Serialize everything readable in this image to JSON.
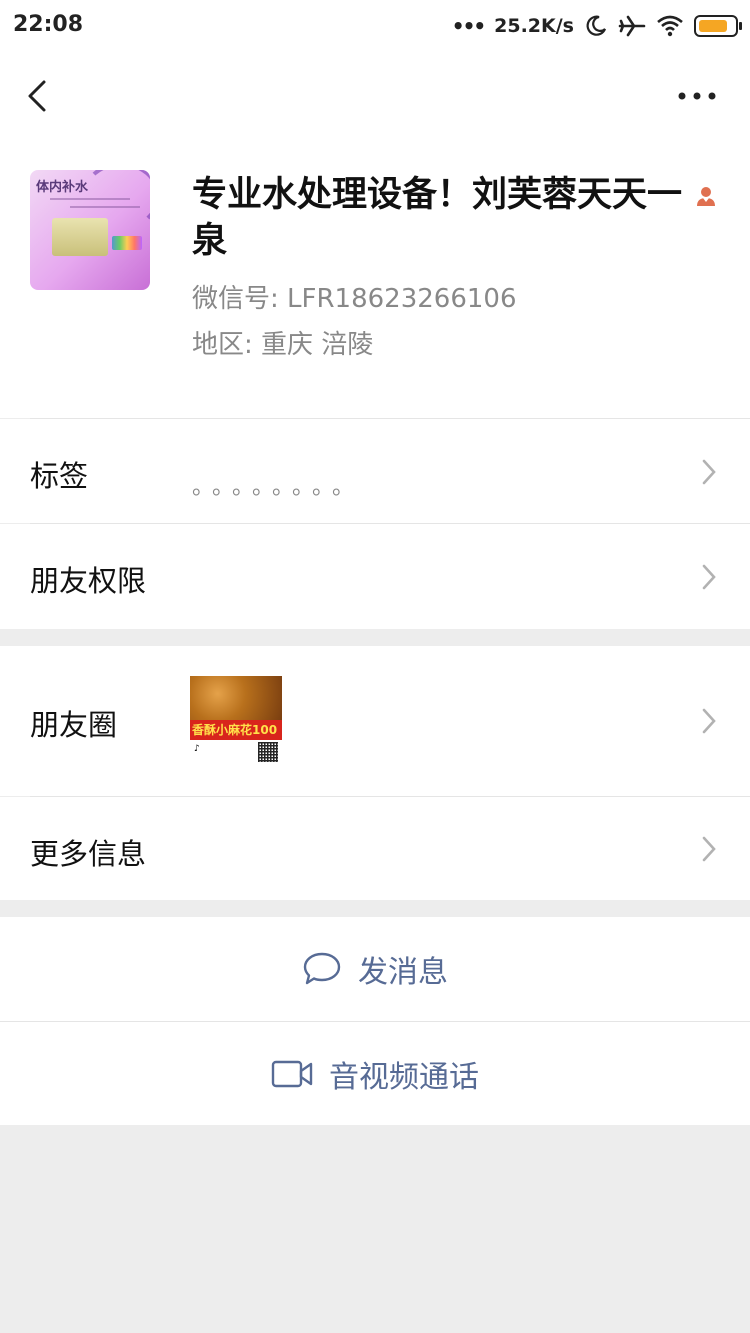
{
  "status_bar": {
    "time": "22:08",
    "dots": "•••",
    "net_speed": "25.2K/s"
  },
  "profile": {
    "avatar_text": "体内补水",
    "name": "专业水处理设备！刘芙蓉天天一泉",
    "wechat_id": "微信号:  LFR18623266106",
    "region": "地区:  重庆  涪陵"
  },
  "rows": {
    "tags_label": "标签",
    "tags_value": "。。。。。。。。",
    "permissions_label": "朋友权限",
    "moments_label": "朋友圈",
    "moments_thumb_text": "香酥小麻花100",
    "more_info_label": "更多信息"
  },
  "actions": {
    "message_label": "发消息",
    "video_call_label": "音视频通话"
  },
  "colors": {
    "link": "#576b95",
    "battery": "#f5a623",
    "person_icon": "#e07050",
    "background": "#ededed"
  }
}
